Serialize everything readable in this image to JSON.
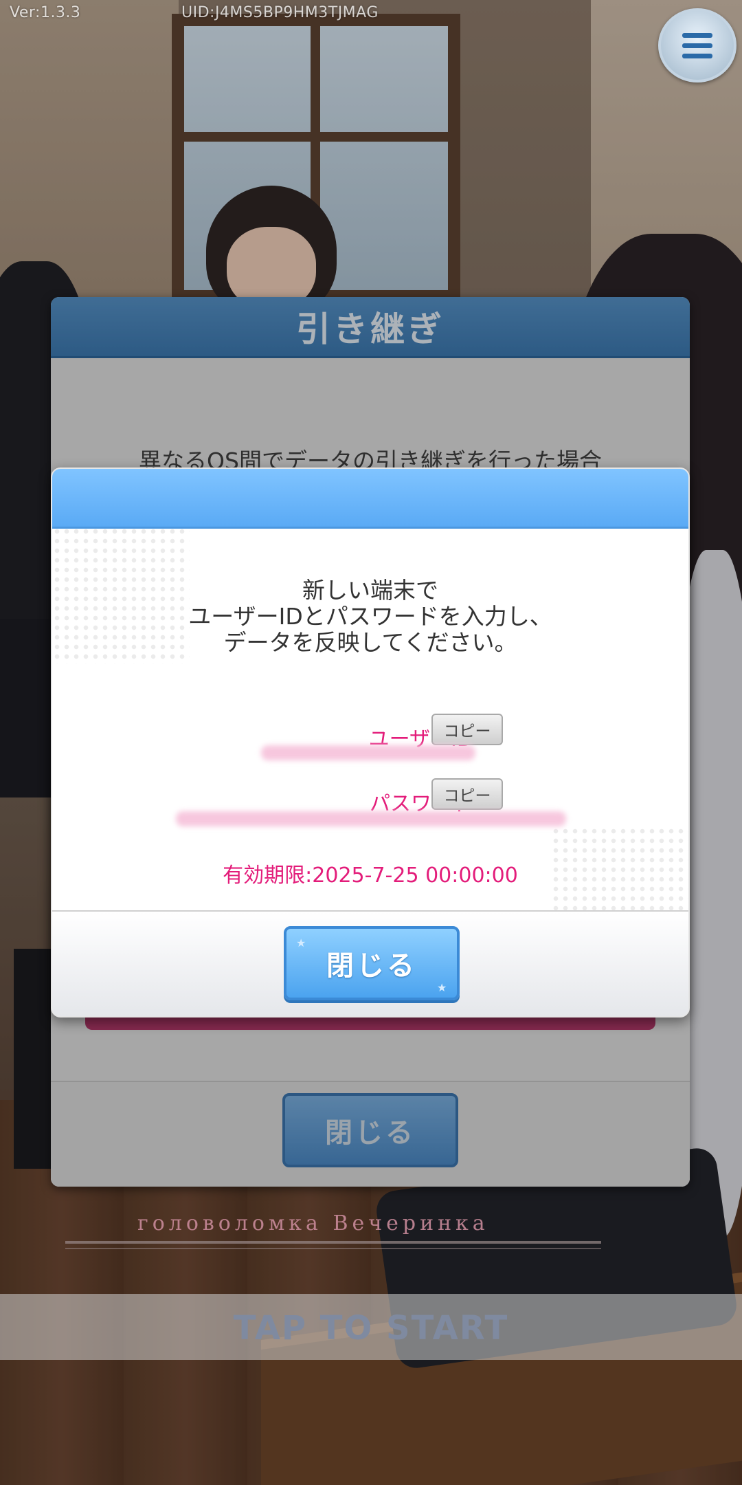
{
  "status": {
    "version": "Ver:1.3.3",
    "uid": "UID:J4MS5BP9HM3TJMAG"
  },
  "header": {
    "menu_icon": "hamburger-menu-icon"
  },
  "back_dialog": {
    "title": "引き継ぎ",
    "text": "異なるOS間でデータの引き継ぎを行った場合",
    "close_label": "閉じる"
  },
  "front_dialog": {
    "message_lines": [
      "新しい端末で",
      "ユーザーIDとパスワードを入力し、",
      "データを反映してください。"
    ],
    "user_id_label": "ユーザーID",
    "password_label": "パスワード",
    "copy_label": "コピー",
    "expiry": "有効期限:2025-7-25 00:00:00",
    "close_label": "閉じる"
  },
  "logo": {
    "subtitle": "головоломка Вечеринка"
  },
  "start": {
    "label": "TAP TO START"
  },
  "colors": {
    "title_bar": "#2f6ea8",
    "front_header": "#5aaaf5",
    "accent_pink": "#e31c7a",
    "close_button": "#4ba3ef"
  }
}
